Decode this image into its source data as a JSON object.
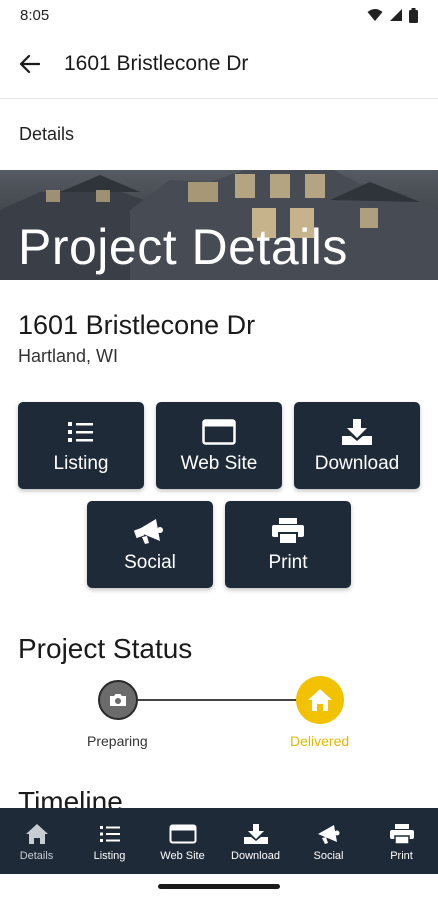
{
  "status_bar": {
    "time": "8:05"
  },
  "app_bar": {
    "title": "1601 Bristlecone Dr"
  },
  "section_label": "Details",
  "hero": {
    "title": "Project Details"
  },
  "property": {
    "address": "1601 Bristlecone Dr",
    "city": "Hartland, WI"
  },
  "actions": [
    {
      "label": "Listing",
      "icon": "list-icon"
    },
    {
      "label": "Web Site",
      "icon": "browser-icon"
    },
    {
      "label": "Download",
      "icon": "download-icon"
    },
    {
      "label": "Social",
      "icon": "megaphone-icon"
    },
    {
      "label": "Print",
      "icon": "printer-icon"
    }
  ],
  "project_status": {
    "heading": "Project Status",
    "steps": [
      {
        "label": "Preparing",
        "icon": "camera-icon",
        "color": "#6b6b6b"
      },
      {
        "label": "Delivered",
        "icon": "home-icon",
        "color": "#f2c200"
      }
    ],
    "current_step": "Delivered"
  },
  "timeline": {
    "heading": "Timeline"
  },
  "bottom_nav": [
    {
      "label": "Details",
      "icon": "home-icon",
      "active": true
    },
    {
      "label": "Listing",
      "icon": "list-icon"
    },
    {
      "label": "Web Site",
      "icon": "browser-icon"
    },
    {
      "label": "Download",
      "icon": "download-icon"
    },
    {
      "label": "Social",
      "icon": "megaphone-icon"
    },
    {
      "label": "Print",
      "icon": "printer-icon"
    }
  ],
  "colors": {
    "tile_bg": "#1e2a38",
    "accent_yellow": "#f2c200",
    "nav_bg": "#1e2a38"
  }
}
